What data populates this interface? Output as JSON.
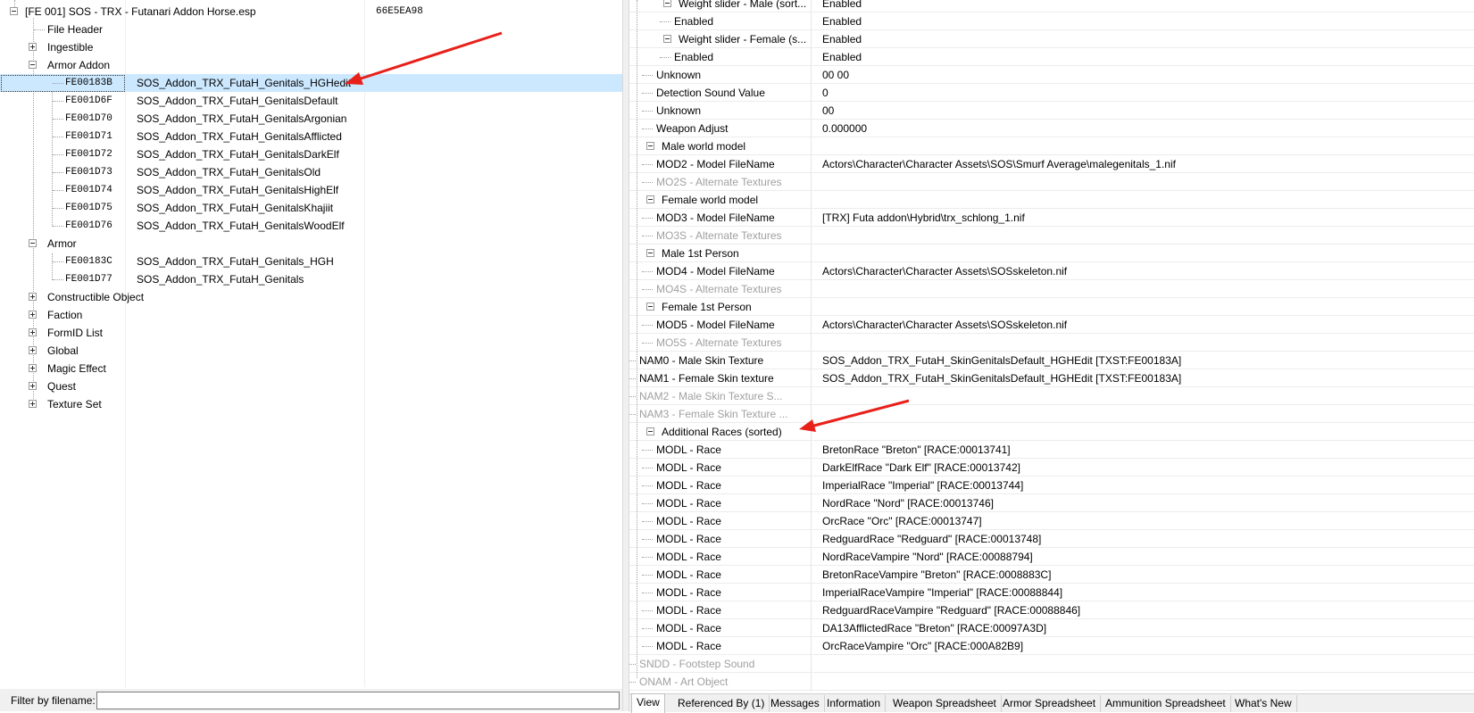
{
  "left_tree": {
    "root": {
      "label": "[FE 001] SOS - TRX - Futanari Addon Horse.esp",
      "crc": "66E5EA98"
    },
    "file_header": "File Header",
    "ingestible": "Ingestible",
    "armor_addon": {
      "label": "Armor Addon",
      "items": [
        {
          "id": "FE00183B",
          "name": "SOS_Addon_TRX_FutaH_Genitals_HGHedit"
        },
        {
          "id": "FE001D6F",
          "name": "SOS_Addon_TRX_FutaH_GenitalsDefault"
        },
        {
          "id": "FE001D70",
          "name": "SOS_Addon_TRX_FutaH_GenitalsArgonian"
        },
        {
          "id": "FE001D71",
          "name": "SOS_Addon_TRX_FutaH_GenitalsAfflicted"
        },
        {
          "id": "FE001D72",
          "name": "SOS_Addon_TRX_FutaH_GenitalsDarkElf"
        },
        {
          "id": "FE001D73",
          "name": "SOS_Addon_TRX_FutaH_GenitalsOld"
        },
        {
          "id": "FE001D74",
          "name": "SOS_Addon_TRX_FutaH_GenitalsHighElf"
        },
        {
          "id": "FE001D75",
          "name": "SOS_Addon_TRX_FutaH_GenitalsKhajiit"
        },
        {
          "id": "FE001D76",
          "name": "SOS_Addon_TRX_FutaH_GenitalsWoodElf"
        }
      ]
    },
    "armor": {
      "label": "Armor",
      "items": [
        {
          "id": "FE00183C",
          "name": "SOS_Addon_TRX_FutaH_Genitals_HGH"
        },
        {
          "id": "FE001D77",
          "name": "SOS_Addon_TRX_FutaH_Genitals"
        }
      ]
    },
    "groups": [
      "Constructible Object",
      "Faction",
      "FormID List",
      "Global",
      "Magic Effect",
      "Quest",
      "Texture Set"
    ]
  },
  "filter": {
    "label": "Filter by filename:",
    "value": ""
  },
  "right_view": {
    "rows": [
      {
        "k": "Weight slider - Male (sort...",
        "v": "Enabled"
      },
      {
        "k": "Enabled",
        "v": "Enabled"
      },
      {
        "k": "Weight slider - Female (s...",
        "v": "Enabled"
      },
      {
        "k": "Enabled",
        "v": "Enabled"
      },
      {
        "k": "Unknown",
        "v": "00 00"
      },
      {
        "k": "Detection Sound Value",
        "v": "0"
      },
      {
        "k": "Unknown",
        "v": "00"
      },
      {
        "k": "Weapon Adjust",
        "v": "0.000000"
      },
      {
        "k": "Male world model",
        "v": ""
      },
      {
        "k": "MOD2 - Model FileName",
        "v": "Actors\\Character\\Character Assets\\SOS\\Smurf Average\\malegenitals_1.nif"
      },
      {
        "k": "MO2S - Alternate Textures",
        "v": ""
      },
      {
        "k": "Female world model",
        "v": ""
      },
      {
        "k": "MOD3 - Model FileName",
        "v": "[TRX] Futa addon\\Hybrid\\trx_schlong_1.nif"
      },
      {
        "k": "MO3S - Alternate Textures",
        "v": ""
      },
      {
        "k": "Male 1st Person",
        "v": ""
      },
      {
        "k": "MOD4 - Model FileName",
        "v": "Actors\\Character\\Character Assets\\SOSskeleton.nif"
      },
      {
        "k": "MO4S - Alternate Textures",
        "v": ""
      },
      {
        "k": "Female 1st Person",
        "v": ""
      },
      {
        "k": "MOD5 - Model FileName",
        "v": "Actors\\Character\\Character Assets\\SOSskeleton.nif"
      },
      {
        "k": "MO5S - Alternate Textures",
        "v": ""
      },
      {
        "k": "NAM0 - Male Skin Texture",
        "v": "SOS_Addon_TRX_FutaH_SkinGenitalsDefault_HGHEdit [TXST:FE00183A]"
      },
      {
        "k": "NAM1 - Female Skin texture",
        "v": "SOS_Addon_TRX_FutaH_SkinGenitalsDefault_HGHEdit [TXST:FE00183A]"
      },
      {
        "k": "NAM2 - Male Skin Texture S...",
        "v": ""
      },
      {
        "k": "NAM3 - Female Skin Texture ...",
        "v": ""
      },
      {
        "k": "Additional Races (sorted)",
        "v": ""
      },
      {
        "k": "MODL - Race",
        "v": "BretonRace \"Breton\" [RACE:00013741]"
      },
      {
        "k": "MODL - Race",
        "v": "DarkElfRace \"Dark Elf\" [RACE:00013742]"
      },
      {
        "k": "MODL - Race",
        "v": "ImperialRace \"Imperial\" [RACE:00013744]"
      },
      {
        "k": "MODL - Race",
        "v": "NordRace \"Nord\" [RACE:00013746]"
      },
      {
        "k": "MODL - Race",
        "v": "OrcRace \"Orc\" [RACE:00013747]"
      },
      {
        "k": "MODL - Race",
        "v": "RedguardRace \"Redguard\" [RACE:00013748]"
      },
      {
        "k": "MODL - Race",
        "v": "NordRaceVampire \"Nord\" [RACE:00088794]"
      },
      {
        "k": "MODL - Race",
        "v": "BretonRaceVampire \"Breton\" [RACE:0008883C]"
      },
      {
        "k": "MODL - Race",
        "v": "ImperialRaceVampire \"Imperial\" [RACE:00088844]"
      },
      {
        "k": "MODL - Race",
        "v": "RedguardRaceVampire \"Redguard\" [RACE:00088846]"
      },
      {
        "k": "MODL - Race",
        "v": "DA13AfflictedRace \"Breton\" [RACE:00097A3D]"
      },
      {
        "k": "MODL - Race",
        "v": "OrcRaceVampire \"Orc\" [RACE:000A82B9]"
      },
      {
        "k": "SNDD - Footstep Sound",
        "v": ""
      },
      {
        "k": "ONAM - Art Object",
        "v": ""
      }
    ]
  },
  "tabs": [
    "View",
    "Referenced By (1)",
    "Messages",
    "Information",
    "Weapon Spreadsheet",
    "Armor Spreadsheet",
    "Ammunition Spreadsheet",
    "What's New"
  ],
  "colors": {
    "selection": "#cce8ff",
    "annotation_arrow": "#e8201a",
    "disabled_text": "#a0a0a0"
  }
}
